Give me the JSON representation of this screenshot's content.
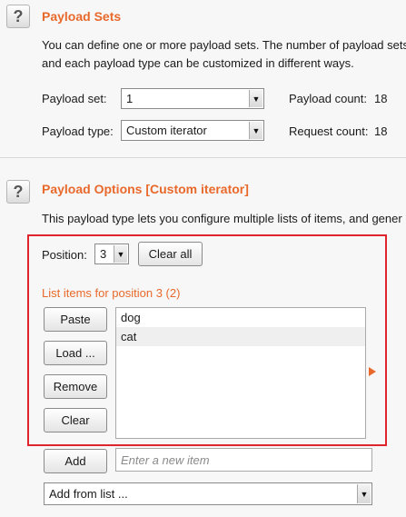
{
  "payload_sets": {
    "title": "Payload Sets",
    "desc_line1": "You can define one or more payload sets. The number of payload sets",
    "desc_line2": "and each payload type can be customized in different ways.",
    "set_label": "Payload set:",
    "set_value": "1",
    "type_label": "Payload type:",
    "type_value": "Custom iterator",
    "count_label": "Payload count:",
    "count_value": "18",
    "request_label": "Request count:",
    "request_value": "18"
  },
  "payload_options": {
    "title": "Payload Options [Custom iterator]",
    "desc": "This payload type lets you configure multiple lists of items, and gener",
    "position_label": "Position:",
    "position_value": "3",
    "clear_all_label": "Clear all",
    "list_caption": "List items for position 3 (2)",
    "buttons": {
      "paste": "Paste",
      "load": "Load ...",
      "remove": "Remove",
      "clear": "Clear",
      "add": "Add"
    },
    "items": [
      "dog",
      "cat"
    ],
    "add_placeholder": "Enter a new item",
    "add_from_list": "Add from list ..."
  },
  "colors": {
    "accent": "#e8692b",
    "highlight_border": "#e0242b"
  },
  "icons": {
    "help": "help-icon",
    "dropdown": "chevron-down-icon",
    "expand": "triangle-right-icon"
  }
}
